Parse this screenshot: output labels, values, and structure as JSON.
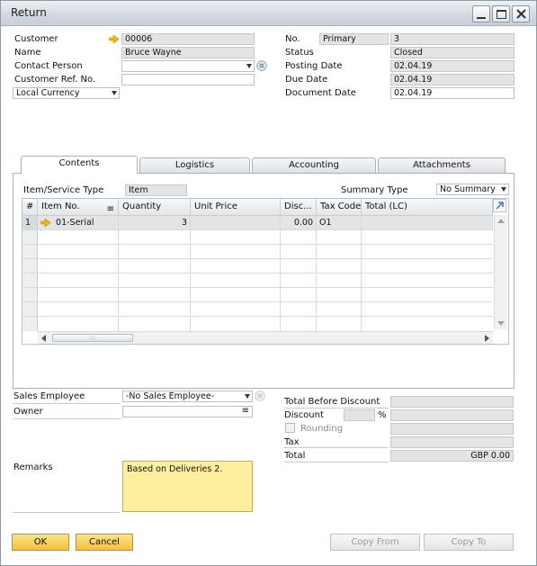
{
  "window": {
    "title": "Return"
  },
  "header_left": {
    "customer": {
      "label": "Customer",
      "value": "00006"
    },
    "name": {
      "label": "Name",
      "value": "Bruce Wayne"
    },
    "contact_person": {
      "label": "Contact Person",
      "value": ""
    },
    "customer_ref": {
      "label": "Customer Ref. No.",
      "value": ""
    },
    "currency": {
      "value": "Local Currency"
    }
  },
  "header_right": {
    "no": {
      "label": "No.",
      "series": "Primary",
      "value": "3"
    },
    "status": {
      "label": "Status",
      "value": "Closed"
    },
    "posting_date": {
      "label": "Posting Date",
      "value": "02.04.19"
    },
    "due_date": {
      "label": "Due Date",
      "value": "02.04.19"
    },
    "document_date": {
      "label": "Document Date",
      "value": "02.04.19"
    }
  },
  "tabs": [
    {
      "label": "Contents",
      "active": true
    },
    {
      "label": "Logistics",
      "active": false
    },
    {
      "label": "Accounting",
      "active": false
    },
    {
      "label": "Attachments",
      "active": false
    }
  ],
  "contents": {
    "item_service_type_label": "Item/Service Type",
    "item_service_type_value": "Item",
    "summary_type_label": "Summary Type",
    "summary_type_value": "No Summary",
    "columns": [
      "#",
      "Item No.",
      "Quantity",
      "Unit Price",
      "Disc...",
      "Tax Code",
      "Total (LC)"
    ],
    "rows": [
      {
        "num": "1",
        "item_no": "01-Serial",
        "quantity": "3",
        "unit_price": "",
        "discount": "0.00",
        "tax_code": "O1",
        "total": ""
      }
    ]
  },
  "footer_left": {
    "sales_employee": {
      "label": "Sales Employee",
      "value": "-No Sales Employee-"
    },
    "owner": {
      "label": "Owner",
      "value": ""
    },
    "remarks": {
      "label": "Remarks",
      "value": "Based on Deliveries 2."
    }
  },
  "totals": {
    "total_before_discount": {
      "label": "Total Before Discount",
      "value": ""
    },
    "discount": {
      "label": "Discount",
      "percent_symbol": "%",
      "percent": "",
      "value": ""
    },
    "rounding": {
      "label": "Rounding",
      "value": ""
    },
    "tax": {
      "label": "Tax",
      "value": ""
    },
    "total": {
      "label": "Total",
      "value": "GBP 0.00"
    }
  },
  "buttons": {
    "ok": "OK",
    "cancel": "Cancel",
    "copy_from": "Copy From",
    "copy_to": "Copy To"
  },
  "colors": {
    "link_arrow": "#f2b705",
    "remarks_background": "#fdeea0",
    "button_yellow": "#f3c23c"
  }
}
